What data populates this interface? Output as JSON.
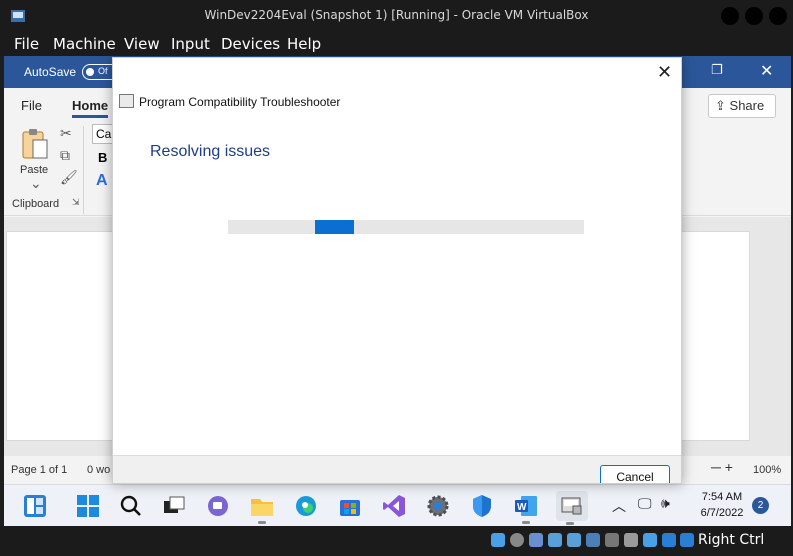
{
  "vbox": {
    "title": "WinDev2204Eval (Snapshot 1) [Running] - Oracle VM VirtualBox",
    "menu": [
      "File",
      "Machine",
      "View",
      "Input",
      "Devices",
      "Help"
    ],
    "host_key": "Right Ctrl"
  },
  "word": {
    "autosave_label": "AutoSave",
    "autosave_state": "Of",
    "tabs": [
      "File",
      "Home"
    ],
    "active_tab": "Home",
    "share_label": "Share",
    "clipboard": {
      "paste_label": "Paste",
      "group_label": "Clipboard"
    },
    "font_box": "Cal",
    "bold_label": "B",
    "status": {
      "page": "Page 1 of 1",
      "words": "0 wo",
      "zoom": "100%"
    }
  },
  "dialog": {
    "title": "Program Compatibility Troubleshooter",
    "heading": "Resolving issues",
    "progress_fraction": 0.11,
    "progress_offset_fraction": 0.245,
    "cancel_label": "Cancel"
  },
  "taskbar": {
    "icons": [
      "widgets-icon",
      "start-icon",
      "search-icon",
      "task-view-icon",
      "teams-chat-icon",
      "file-explorer-icon",
      "edge-icon",
      "store-icon",
      "visual-studio-icon",
      "settings-icon",
      "defender-icon",
      "word-icon",
      "troubleshooter-icon"
    ],
    "time": "7:54 AM",
    "date": "6/7/2022",
    "notification_count": "2"
  },
  "colors": {
    "word_blue": "#2b579a",
    "progress_blue": "#0b6fd2",
    "dialog_heading": "#1d3e87"
  }
}
